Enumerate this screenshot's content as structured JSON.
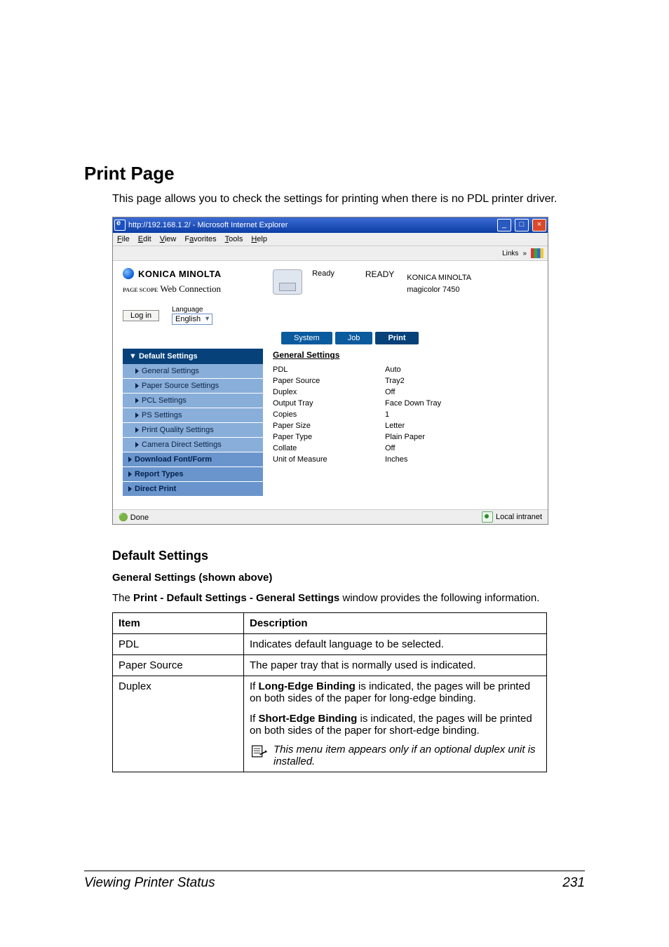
{
  "heading": "Print Page",
  "intro": "This page allows you to check the settings for printing when there is no PDL printer driver.",
  "browser": {
    "title": "http://192.168.1.2/ - Microsoft Internet Explorer",
    "menus": [
      "File",
      "Edit",
      "View",
      "Favorites",
      "Tools",
      "Help"
    ],
    "links_label": "Links",
    "brand": "KONICA MINOLTA",
    "webconn_prefix": "PAGE SCOPE",
    "webconn": "Web Connection",
    "login": "Log in",
    "lang_label": "Language",
    "lang_value": "English",
    "status_ready_small": "Ready",
    "status_ready_big": "READY",
    "right1": "KONICA MINOLTA",
    "right2": "magicolor 7450",
    "tabs": [
      "System",
      "Job",
      "Print"
    ],
    "side_header": "▼ Default Settings",
    "side_items": [
      "General Settings",
      "Paper Source Settings",
      "PCL Settings",
      "PS Settings",
      "Print Quality Settings",
      "Camera Direct Settings"
    ],
    "side_bottom": [
      "Download Font/Form",
      "Report Types",
      "Direct Print"
    ],
    "panel_title": "General Settings",
    "kv": [
      {
        "k": "PDL",
        "v": "Auto"
      },
      {
        "k": "Paper Source",
        "v": "Tray2"
      },
      {
        "k": "Duplex",
        "v": "Off"
      },
      {
        "k": "Output Tray",
        "v": "Face Down Tray"
      },
      {
        "k": "Copies",
        "v": "1"
      },
      {
        "k": "Paper Size",
        "v": "Letter"
      },
      {
        "k": "Paper Type",
        "v": "Plain Paper"
      },
      {
        "k": "Collate",
        "v": "Off"
      },
      {
        "k": "Unit of Measure",
        "v": "Inches"
      }
    ],
    "status_done": "Done",
    "status_zone": "Local intranet"
  },
  "section2": "Default Settings",
  "section3": "General Settings (shown above)",
  "para2a": "The ",
  "para2b": "Print - Default Settings - General Settings",
  "para2c": " window provides the following information.",
  "table": {
    "h1": "Item",
    "h2": "Description",
    "rows": [
      {
        "item": "PDL",
        "desc": "Indicates default language to be selected."
      },
      {
        "item": "Paper Source",
        "desc": "The paper tray that is normally used is indicated."
      }
    ],
    "duplex_item": "Duplex",
    "duplex_p1a": "If ",
    "duplex_p1b": "Long-Edge Binding",
    "duplex_p1c": " is indicated, the pages will be printed on both sides of the paper for long-edge binding.",
    "duplex_p2a": "If ",
    "duplex_p2b": "Short-Edge Binding",
    "duplex_p2c": " is indicated, the pages will be printed on both sides of the paper for short-edge binding.",
    "duplex_note": "This menu item appears only if an optional duplex unit is installed."
  },
  "footer_left": "Viewing Printer Status",
  "footer_right": "231"
}
